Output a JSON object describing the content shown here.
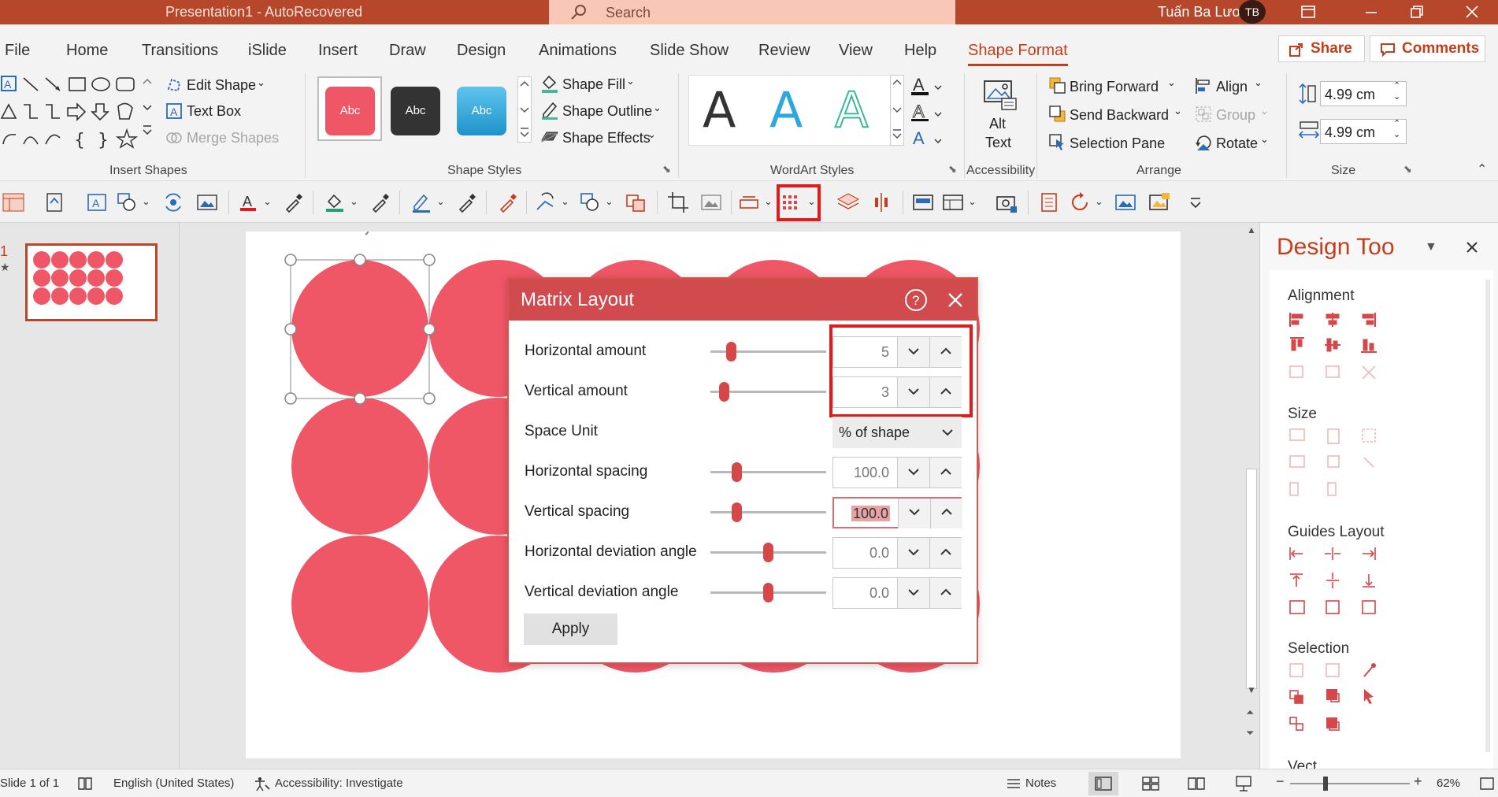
{
  "titlebar": {
    "title": "Presentation1  -  AutoRecovered",
    "search_placeholder": "Search",
    "user": "Tuấn Ba Lương",
    "initials": "TB"
  },
  "tabs": [
    "File",
    "Home",
    "Transitions",
    "iSlide",
    "Insert",
    "Draw",
    "Design",
    "Animations",
    "Slide Show",
    "Review",
    "View",
    "Help",
    "Shape Format"
  ],
  "active_tab": "Shape Format",
  "share_label": "Share",
  "comments_label": "Comments",
  "ribbon": {
    "groups": [
      "Insert Shapes",
      "Shape Styles",
      "WordArt Styles",
      "Accessibility",
      "Arrange",
      "Size"
    ],
    "edit_shape": "Edit Shape",
    "text_box": "Text Box",
    "merge_shapes": "Merge Shapes",
    "style_swatch_text": "Abc",
    "shape_fill": "Shape Fill",
    "shape_outline": "Shape Outline",
    "shape_effects": "Shape Effects",
    "wordart_letter": "A",
    "alt_text_1": "Alt",
    "alt_text_2": "Text",
    "bring_forward": "Bring Forward",
    "send_backward": "Send Backward",
    "selection_pane": "Selection Pane",
    "align": "Align",
    "group": "Group",
    "rotate": "Rotate",
    "height": "4.99 cm",
    "width": "4.99 cm"
  },
  "slide_number": "1",
  "dialog": {
    "title": "Matrix Layout",
    "rows": [
      {
        "label": "Horizontal amount",
        "value": "5",
        "slider": 0.15
      },
      {
        "label": "Vertical amount",
        "value": "3",
        "slider": 0.08
      },
      {
        "label": "Space Unit",
        "value": "% of shape"
      },
      {
        "label": "Horizontal spacing",
        "value": "100.0",
        "slider": 0.2
      },
      {
        "label": "Vertical spacing",
        "value": "100.0",
        "slider": 0.2
      },
      {
        "label": "Horizontal deviation angle",
        "value": "0.0",
        "slider": 0.5
      },
      {
        "label": "Vertical deviation angle",
        "value": "0.0",
        "slider": 0.5
      }
    ],
    "apply": "Apply"
  },
  "design_tools": {
    "title": "Design Tools",
    "sections": [
      "Alignment",
      "Size",
      "Guides Layout",
      "Selection",
      "Vect"
    ]
  },
  "status": {
    "slide": "Slide 1 of 1",
    "language": "English (United States)",
    "accessibility": "Accessibility: Investigate",
    "notes": "Notes",
    "zoom": "62%"
  },
  "colors": {
    "accent": "#b7472a",
    "shape": "#ef5766",
    "dialog_header": "#d14a4d"
  }
}
